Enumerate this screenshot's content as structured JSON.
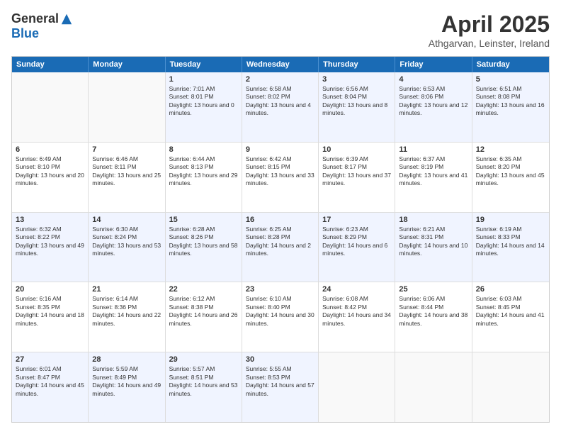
{
  "logo": {
    "general": "General",
    "blue": "Blue"
  },
  "title": "April 2025",
  "subtitle": "Athgarvan, Leinster, Ireland",
  "days": [
    "Sunday",
    "Monday",
    "Tuesday",
    "Wednesday",
    "Thursday",
    "Friday",
    "Saturday"
  ],
  "rows": [
    [
      {
        "day": "",
        "info": ""
      },
      {
        "day": "",
        "info": ""
      },
      {
        "day": "1",
        "info": "Sunrise: 7:01 AM\nSunset: 8:01 PM\nDaylight: 13 hours and 0 minutes."
      },
      {
        "day": "2",
        "info": "Sunrise: 6:58 AM\nSunset: 8:02 PM\nDaylight: 13 hours and 4 minutes."
      },
      {
        "day": "3",
        "info": "Sunrise: 6:56 AM\nSunset: 8:04 PM\nDaylight: 13 hours and 8 minutes."
      },
      {
        "day": "4",
        "info": "Sunrise: 6:53 AM\nSunset: 8:06 PM\nDaylight: 13 hours and 12 minutes."
      },
      {
        "day": "5",
        "info": "Sunrise: 6:51 AM\nSunset: 8:08 PM\nDaylight: 13 hours and 16 minutes."
      }
    ],
    [
      {
        "day": "6",
        "info": "Sunrise: 6:49 AM\nSunset: 8:10 PM\nDaylight: 13 hours and 20 minutes."
      },
      {
        "day": "7",
        "info": "Sunrise: 6:46 AM\nSunset: 8:11 PM\nDaylight: 13 hours and 25 minutes."
      },
      {
        "day": "8",
        "info": "Sunrise: 6:44 AM\nSunset: 8:13 PM\nDaylight: 13 hours and 29 minutes."
      },
      {
        "day": "9",
        "info": "Sunrise: 6:42 AM\nSunset: 8:15 PM\nDaylight: 13 hours and 33 minutes."
      },
      {
        "day": "10",
        "info": "Sunrise: 6:39 AM\nSunset: 8:17 PM\nDaylight: 13 hours and 37 minutes."
      },
      {
        "day": "11",
        "info": "Sunrise: 6:37 AM\nSunset: 8:19 PM\nDaylight: 13 hours and 41 minutes."
      },
      {
        "day": "12",
        "info": "Sunrise: 6:35 AM\nSunset: 8:20 PM\nDaylight: 13 hours and 45 minutes."
      }
    ],
    [
      {
        "day": "13",
        "info": "Sunrise: 6:32 AM\nSunset: 8:22 PM\nDaylight: 13 hours and 49 minutes."
      },
      {
        "day": "14",
        "info": "Sunrise: 6:30 AM\nSunset: 8:24 PM\nDaylight: 13 hours and 53 minutes."
      },
      {
        "day": "15",
        "info": "Sunrise: 6:28 AM\nSunset: 8:26 PM\nDaylight: 13 hours and 58 minutes."
      },
      {
        "day": "16",
        "info": "Sunrise: 6:25 AM\nSunset: 8:28 PM\nDaylight: 14 hours and 2 minutes."
      },
      {
        "day": "17",
        "info": "Sunrise: 6:23 AM\nSunset: 8:29 PM\nDaylight: 14 hours and 6 minutes."
      },
      {
        "day": "18",
        "info": "Sunrise: 6:21 AM\nSunset: 8:31 PM\nDaylight: 14 hours and 10 minutes."
      },
      {
        "day": "19",
        "info": "Sunrise: 6:19 AM\nSunset: 8:33 PM\nDaylight: 14 hours and 14 minutes."
      }
    ],
    [
      {
        "day": "20",
        "info": "Sunrise: 6:16 AM\nSunset: 8:35 PM\nDaylight: 14 hours and 18 minutes."
      },
      {
        "day": "21",
        "info": "Sunrise: 6:14 AM\nSunset: 8:36 PM\nDaylight: 14 hours and 22 minutes."
      },
      {
        "day": "22",
        "info": "Sunrise: 6:12 AM\nSunset: 8:38 PM\nDaylight: 14 hours and 26 minutes."
      },
      {
        "day": "23",
        "info": "Sunrise: 6:10 AM\nSunset: 8:40 PM\nDaylight: 14 hours and 30 minutes."
      },
      {
        "day": "24",
        "info": "Sunrise: 6:08 AM\nSunset: 8:42 PM\nDaylight: 14 hours and 34 minutes."
      },
      {
        "day": "25",
        "info": "Sunrise: 6:06 AM\nSunset: 8:44 PM\nDaylight: 14 hours and 38 minutes."
      },
      {
        "day": "26",
        "info": "Sunrise: 6:03 AM\nSunset: 8:45 PM\nDaylight: 14 hours and 41 minutes."
      }
    ],
    [
      {
        "day": "27",
        "info": "Sunrise: 6:01 AM\nSunset: 8:47 PM\nDaylight: 14 hours and 45 minutes."
      },
      {
        "day": "28",
        "info": "Sunrise: 5:59 AM\nSunset: 8:49 PM\nDaylight: 14 hours and 49 minutes."
      },
      {
        "day": "29",
        "info": "Sunrise: 5:57 AM\nSunset: 8:51 PM\nDaylight: 14 hours and 53 minutes."
      },
      {
        "day": "30",
        "info": "Sunrise: 5:55 AM\nSunset: 8:53 PM\nDaylight: 14 hours and 57 minutes."
      },
      {
        "day": "",
        "info": ""
      },
      {
        "day": "",
        "info": ""
      },
      {
        "day": "",
        "info": ""
      }
    ]
  ]
}
